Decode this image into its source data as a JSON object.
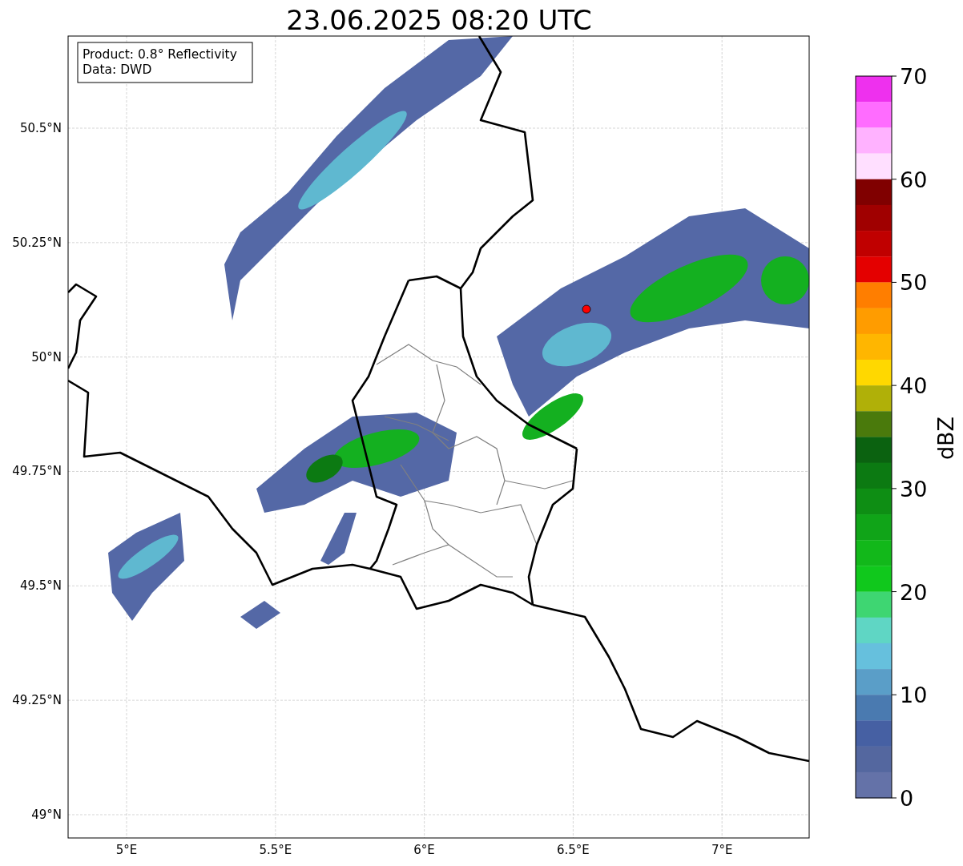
{
  "title": "23.06.2025 08:20 UTC",
  "info_box": {
    "lines": [
      "Product: 0.8° Reflectivity",
      "Data: DWD"
    ]
  },
  "map": {
    "latitude_labels": [
      "50.5°N",
      "50.25°N",
      "50°N",
      "49.75°N",
      "49.5°N",
      "49.25°N",
      "49°N"
    ],
    "longitude_labels": [
      "5°E",
      "5.5°E",
      "6°E",
      "6.5°E",
      "7°E"
    ]
  },
  "colorbar": {
    "label": "dBZ",
    "ticks": [
      "70",
      "60",
      "50",
      "40",
      "30",
      "20",
      "10",
      "0"
    ],
    "bins": [
      {
        "color": "#ee30ee"
      },
      {
        "color": "#ff6cff"
      },
      {
        "color": "#ffb2ff"
      },
      {
        "color": "#ffdfff"
      },
      {
        "color": "#800000"
      },
      {
        "color": "#a00000"
      },
      {
        "color": "#c00000"
      },
      {
        "color": "#e40000"
      },
      {
        "color": "#ff7e00"
      },
      {
        "color": "#ff9c00"
      },
      {
        "color": "#ffb600"
      },
      {
        "color": "#ffd800"
      },
      {
        "color": "#b0b008"
      },
      {
        "color": "#4a7a0c"
      },
      {
        "color": "#0b6210"
      },
      {
        "color": "#0c7a12"
      },
      {
        "color": "#0e8e14"
      },
      {
        "color": "#10a418"
      },
      {
        "color": "#12b81a"
      },
      {
        "color": "#10c81c"
      },
      {
        "color": "#3ed672"
      },
      {
        "color": "#5fd6c4"
      },
      {
        "color": "#66c0dd"
      },
      {
        "color": "#5a9ec8"
      },
      {
        "color": "#4a7ab0"
      },
      {
        "color": "#4660a3"
      },
      {
        "color": "#54679f"
      },
      {
        "color": "#6472a8"
      }
    ]
  }
}
